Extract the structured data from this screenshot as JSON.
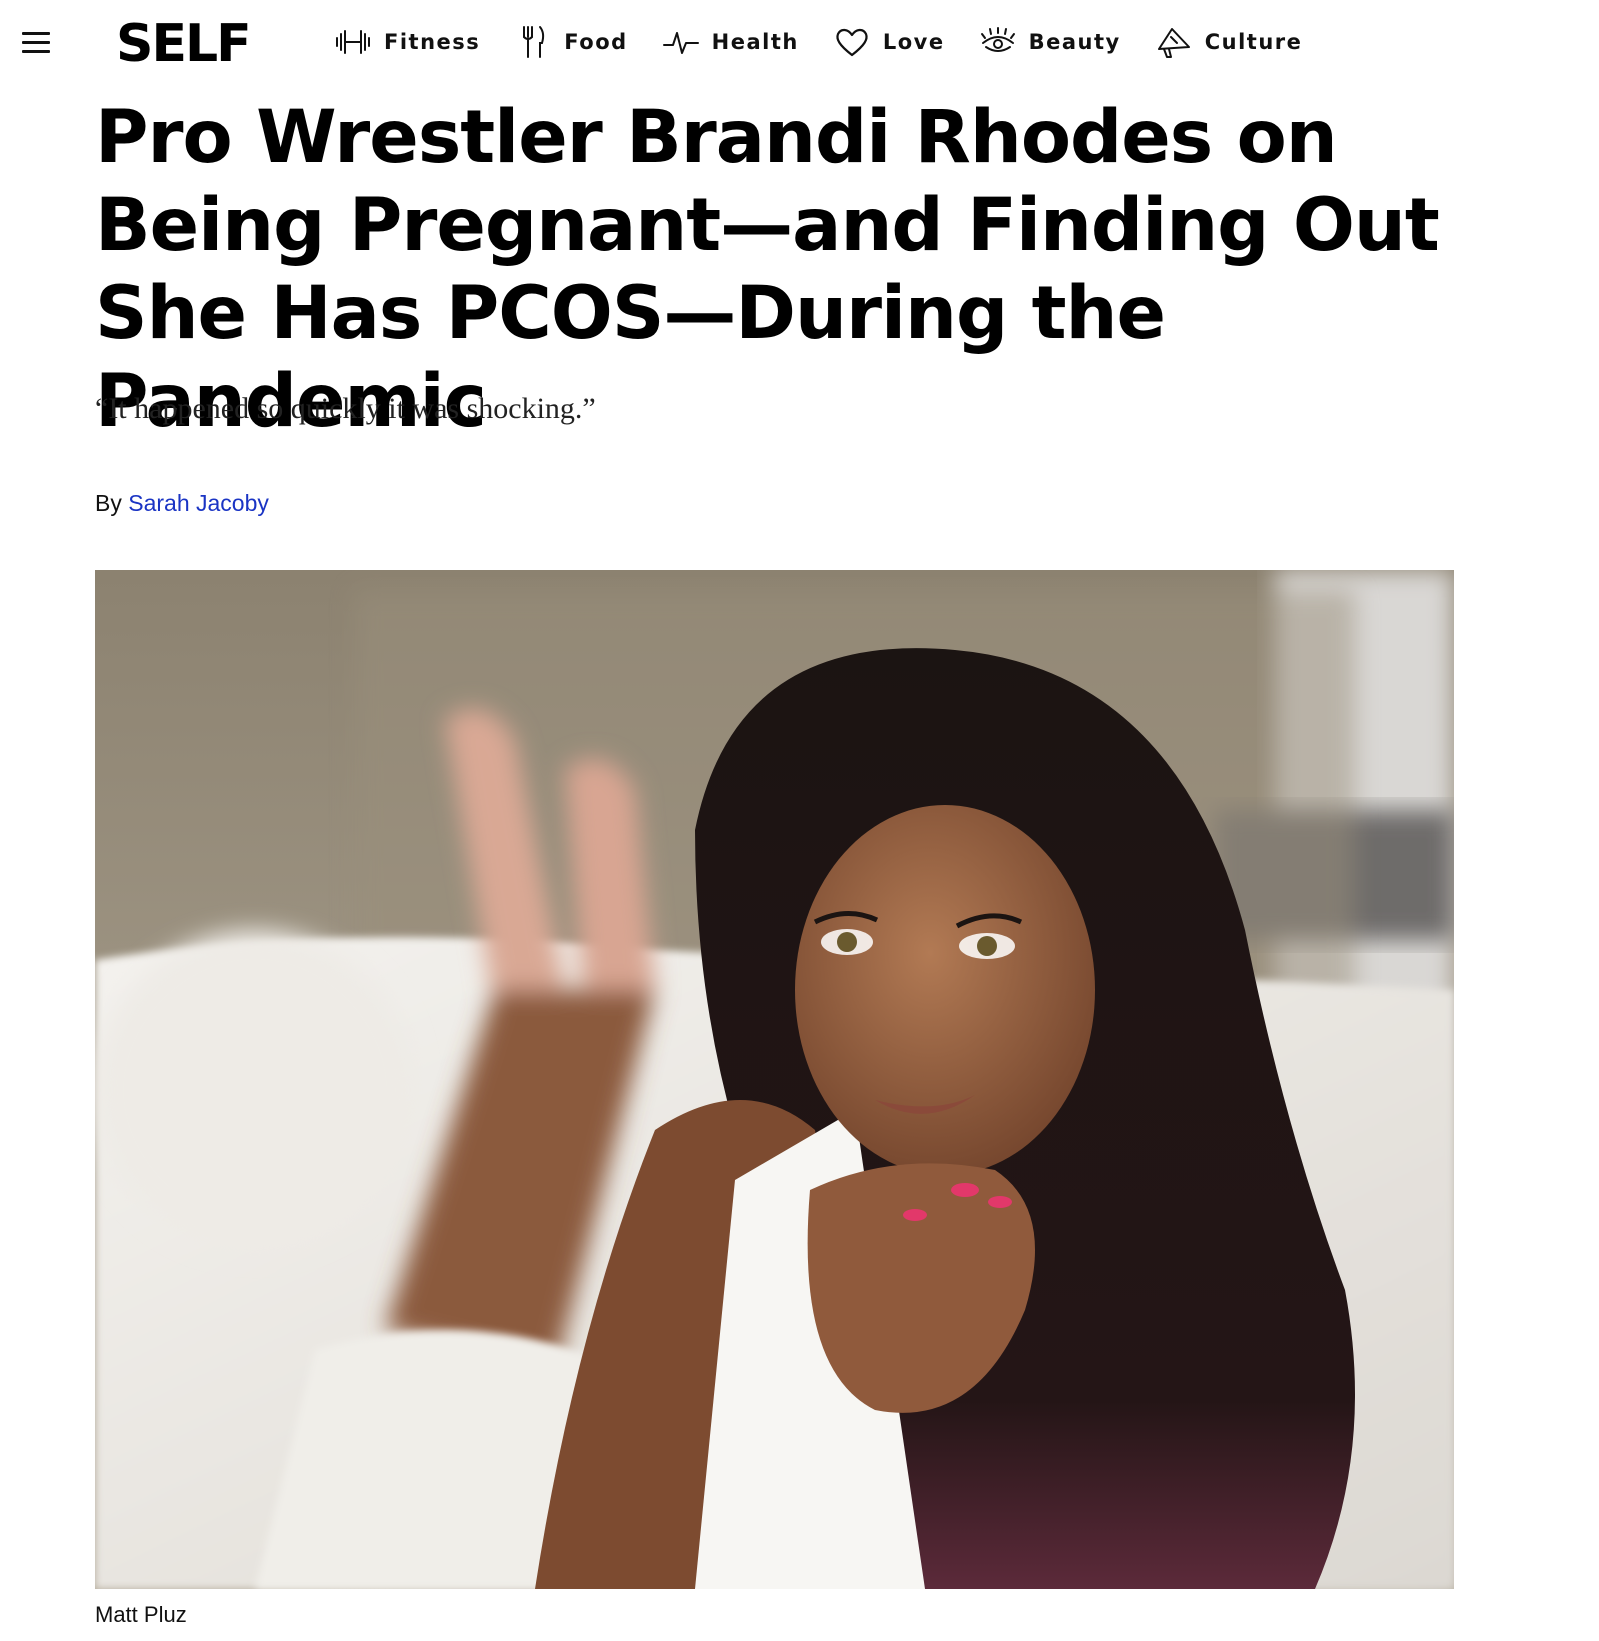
{
  "header": {
    "logo": "SELF",
    "nav": [
      {
        "label": "Fitness",
        "icon": "dumbbell-icon"
      },
      {
        "label": "Food",
        "icon": "fork-knife-icon"
      },
      {
        "label": "Health",
        "icon": "heartbeat-icon"
      },
      {
        "label": "Love",
        "icon": "heart-icon"
      },
      {
        "label": "Beauty",
        "icon": "eyelash-icon"
      },
      {
        "label": "Culture",
        "icon": "megaphone-icon"
      }
    ]
  },
  "article": {
    "headline": "Pro Wrestler Brandi Rhodes on Being Pregnant—and Finding Out She Has PCOS—During the Pandemic",
    "dek": "“It happened so quickly it was shocking.”",
    "byline_prefix": "By",
    "author": "Sarah Jacoby",
    "photo_credit": "Matt Pluz"
  },
  "colors": {
    "author_link": "#1a34c4",
    "text": "#000000"
  }
}
